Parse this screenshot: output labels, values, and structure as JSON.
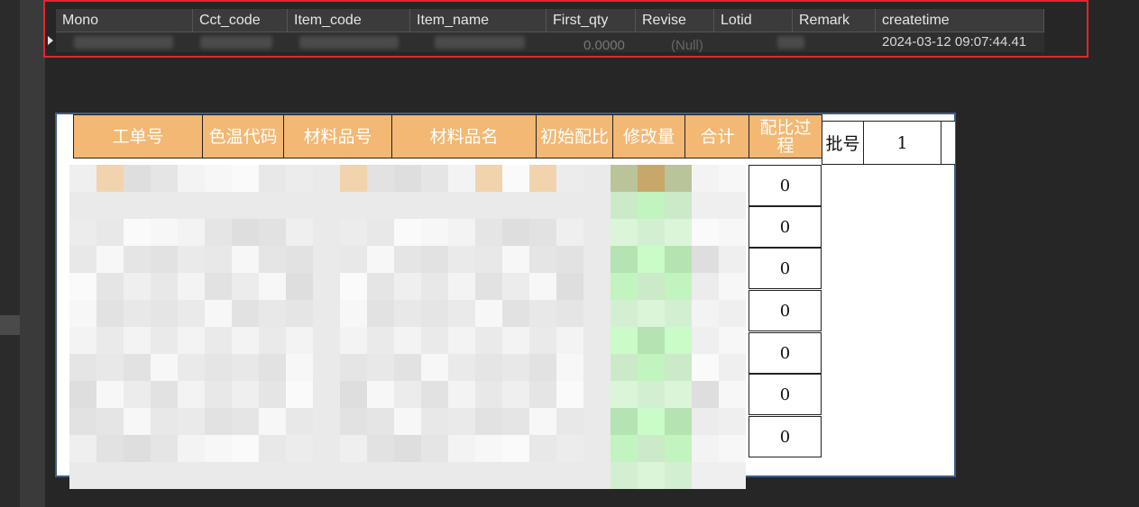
{
  "grid": {
    "columns": [
      "Mono",
      "Cct_code",
      "Item_code",
      "Item_name",
      "First_qty",
      "Revise",
      "Lotid",
      "Remark",
      "createtime"
    ],
    "row": {
      "createtime": "2024-03-12 09:07:44.41",
      "first_qty": "0.0000",
      "revise": "(Null)"
    }
  },
  "sheet": {
    "headers": [
      "工单号",
      "色温代码",
      "材料品号",
      "材料品名",
      "初始配比",
      "修改量",
      "合计",
      "配比过程"
    ],
    "batch_label": "批号",
    "batch_value": "1",
    "zero_values": [
      "0",
      "0",
      "0",
      "0",
      "0",
      "0",
      "0"
    ]
  },
  "colors": {
    "highlight": "#e0262e",
    "header_bg": "#f2b874",
    "green": "#c9fcc6"
  }
}
